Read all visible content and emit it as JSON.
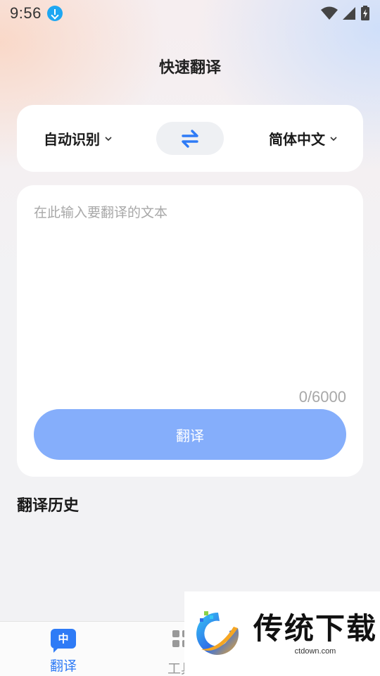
{
  "status_bar": {
    "time": "9:56"
  },
  "header": {
    "title": "快速翻译"
  },
  "lang_bar": {
    "source": "自动识别",
    "target": "简体中文"
  },
  "input": {
    "placeholder": "在此输入要翻译的文本",
    "value": "",
    "counter": "0/6000"
  },
  "translate_button": {
    "label": "翻译"
  },
  "history": {
    "title": "翻译历史"
  },
  "tabs": [
    {
      "label": "翻译",
      "icon_text": "中",
      "active": true
    },
    {
      "label": "工具",
      "active": false
    }
  ],
  "watermark": {
    "title": "传统下载",
    "subtitle": "ctdown.com"
  },
  "colors": {
    "accent": "#2e7bf6",
    "button": "#85aefb"
  }
}
